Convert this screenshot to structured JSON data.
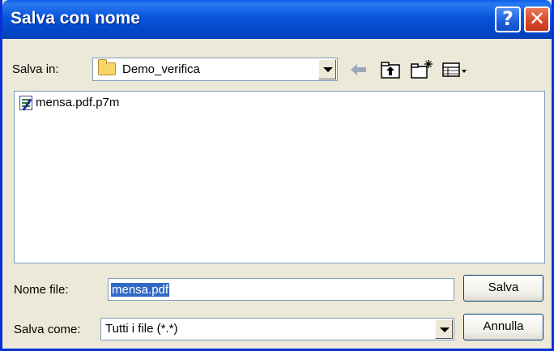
{
  "window": {
    "title": "Salva con nome",
    "help_glyph": "?",
    "close_glyph": "✕"
  },
  "location": {
    "label": "Salva in:",
    "value": "Demo_verifica"
  },
  "toolbar": {
    "icons": [
      "back-arrow-icon",
      "up-folder-icon",
      "new-folder-icon",
      "view-menu-icon"
    ]
  },
  "files": [
    {
      "name": "mensa.pdf.p7m",
      "icon": "signed-document-icon"
    }
  ],
  "filename": {
    "label": "Nome file:",
    "value": "mensa.pdf"
  },
  "filetype": {
    "label": "Salva come:",
    "value": "Tutti i file (*.*)"
  },
  "buttons": {
    "save": "Salva",
    "cancel": "Annulla"
  },
  "colors": {
    "titlebar": "#0855dd",
    "selection": "#316ac5",
    "close_button": "#d8482c"
  }
}
